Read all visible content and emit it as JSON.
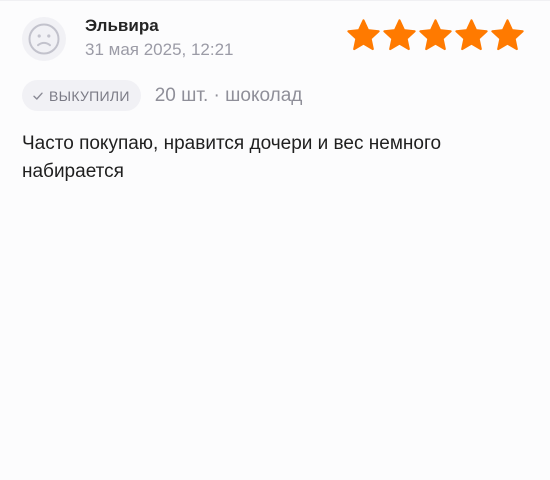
{
  "review": {
    "author": "Эльвира",
    "date": "31 мая 2025, 12:21",
    "rating": 5,
    "rating_max": 5,
    "badge_label": "ВЫКУПИЛИ",
    "variant": "20 шт. · шоколад",
    "text": "Часто покупаю, нравится дочери и вес немного набирается"
  },
  "icons": {
    "avatar": "user-avatar-placeholder-icon",
    "badge": "check-icon",
    "star": "star-icon"
  },
  "colors": {
    "star": "#ff7a00",
    "badge_bg": "#f1f1f5",
    "muted_text": "#9b9ba6",
    "text": "#1f1f1f"
  }
}
